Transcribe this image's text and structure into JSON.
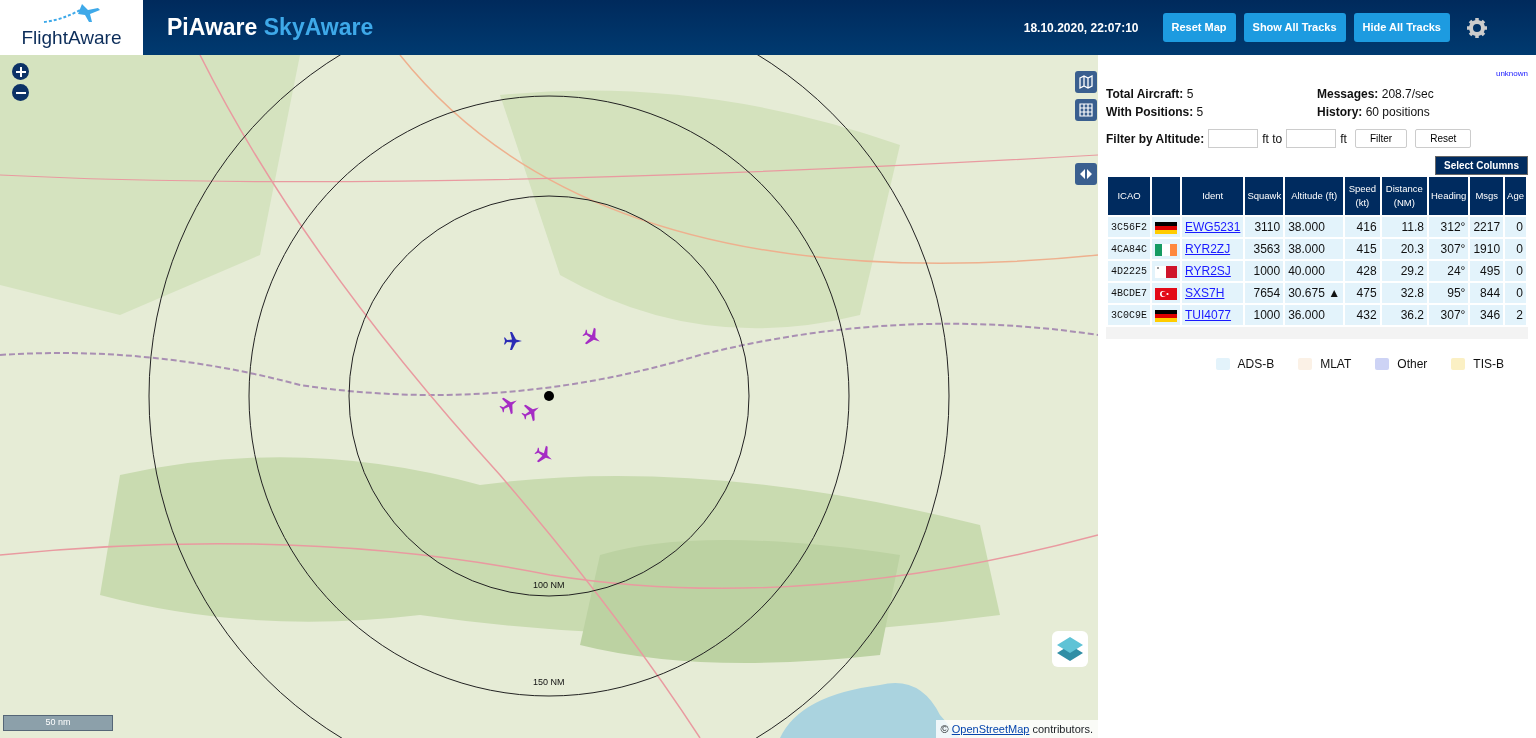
{
  "header": {
    "logo_text": "FlightAware",
    "app_title": "PiAware",
    "app_subtitle": "SkyAware",
    "clock": "18.10.2020, 22:07:10",
    "buttons": [
      "Reset Map",
      "Show All Tracks",
      "Hide All Tracks"
    ]
  },
  "map": {
    "ring_labels": [
      "100 NM",
      "150 NM"
    ],
    "scale": "50 nm",
    "attribution_prefix": "©",
    "attribution_link": "OpenStreetMap",
    "attribution_suffix": "contributors.",
    "markers": [
      {
        "color": "#2b2bb5"
      },
      {
        "color": "#a52cc4"
      },
      {
        "color": "#a52cc4"
      },
      {
        "color": "#a52cc4"
      },
      {
        "color": "#a52cc4"
      }
    ]
  },
  "sidebar": {
    "version": "unknown",
    "stats": [
      {
        "label": "Total Aircraft:",
        "value": "5"
      },
      {
        "label": "Messages:",
        "value": "208.7/sec"
      },
      {
        "label": "With Positions:",
        "value": "5"
      },
      {
        "label": "History:",
        "value": "60 positions"
      }
    ],
    "filter": {
      "label": "Filter by Altitude:",
      "to": "ft to",
      "unit": "ft",
      "buttons": [
        "Filter",
        "Reset"
      ]
    },
    "select_columns": "Select Columns",
    "columns": [
      "ICAO",
      "",
      "Ident",
      "Squawk",
      "Altitude (ft)",
      "Speed (kt)",
      "Distance (NM)",
      "Heading",
      "Msgs",
      "Age"
    ],
    "rows": [
      {
        "color": "#e3f3fb",
        "kind": "de",
        "icao": "3C56F2",
        "ident": "EWG5231",
        "squawk": "3110",
        "altitude": "38.000",
        "speed": "416",
        "distance": "11.8",
        "heading": "312°",
        "msgs": "2217",
        "age": "0"
      },
      {
        "color": "#e3f3fb",
        "kind": "ie",
        "icao": "4CA84C",
        "ident": "RYR2ZJ",
        "squawk": "3563",
        "altitude": "38.000",
        "speed": "415",
        "distance": "20.3",
        "heading": "307°",
        "msgs": "1910",
        "age": "0"
      },
      {
        "color": "#e3f3fb",
        "kind": "mt",
        "icao": "4D2225",
        "ident": "RYR2SJ",
        "squawk": "1000",
        "altitude": "40.000",
        "speed": "428",
        "distance": "29.2",
        "heading": "24°",
        "msgs": "495",
        "age": "0"
      },
      {
        "color": "#e3f3fb",
        "kind": "tr",
        "icao": "4BCDE7",
        "ident": "SXS7H",
        "squawk": "7654",
        "altitude": "30.675 ▲",
        "speed": "475",
        "distance": "32.8",
        "heading": "95°",
        "msgs": "844",
        "age": "0"
      },
      {
        "color": "#e3f3fb",
        "kind": "de",
        "icao": "3C0C9E",
        "ident": "TUI4077",
        "squawk": "1000",
        "altitude": "36.000",
        "speed": "432",
        "distance": "36.2",
        "heading": "307°",
        "msgs": "346",
        "age": "2"
      }
    ],
    "legend": [
      {
        "label": "ADS-B",
        "color": "#e3f3fb"
      },
      {
        "label": "MLAT",
        "color": "#fbf1e6"
      },
      {
        "label": "Other",
        "color": "#cdd3f5"
      },
      {
        "label": "TIS-B",
        "color": "#fbf0c4"
      }
    ]
  }
}
